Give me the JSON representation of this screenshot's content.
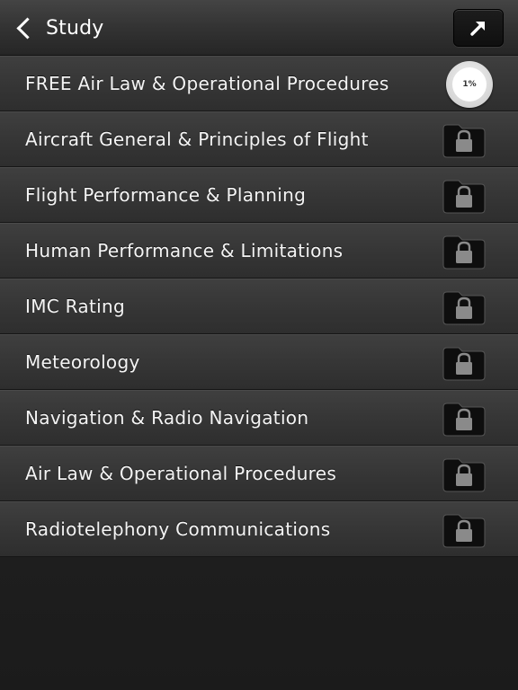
{
  "navbar": {
    "back_label": "Study",
    "share_icon": "share-arrow-icon"
  },
  "list": [
    {
      "label": "FREE Air Law & Operational Procedures",
      "status": "progress",
      "progress_text": "1%"
    },
    {
      "label": "Aircraft General & Principles of Flight",
      "status": "locked"
    },
    {
      "label": "Flight Performance & Planning",
      "status": "locked"
    },
    {
      "label": "Human Performance & Limitations",
      "status": "locked"
    },
    {
      "label": "IMC Rating",
      "status": "locked"
    },
    {
      "label": "Meteorology",
      "status": "locked"
    },
    {
      "label": "Navigation & Radio Navigation",
      "status": "locked"
    },
    {
      "label": "Air Law & Operational Procedures",
      "status": "locked"
    },
    {
      "label": "Radiotelephony Communications",
      "status": "locked"
    }
  ],
  "colors": {
    "row_top": "#3f3f3f",
    "row_bottom": "#2e2e2e",
    "background": "#1b1b1b",
    "text": "#f4f4f4"
  }
}
